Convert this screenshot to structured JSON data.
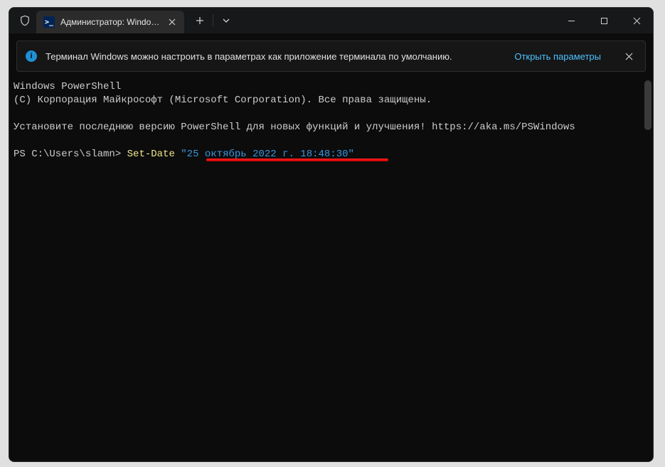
{
  "tab": {
    "title": "Администратор: Windows Po"
  },
  "infobar": {
    "text": "Терминал Windows можно настроить в параметрах как приложение терминала по умолчанию.",
    "link": "Открыть параметры"
  },
  "terminal": {
    "line1": "Windows PowerShell",
    "line2": "(C) Корпорация Майкрософт (Microsoft Corporation). Все права защищены.",
    "line3": "Установите последнюю версию PowerShell для новых функций и улучшения! https://aka.ms/PSWindows",
    "prompt": "PS C:\\Users\\slamn> ",
    "cmdlet": "Set-Date",
    "space": " ",
    "arg": "\"25 октябрь 2022 г. 18:48:30\""
  }
}
